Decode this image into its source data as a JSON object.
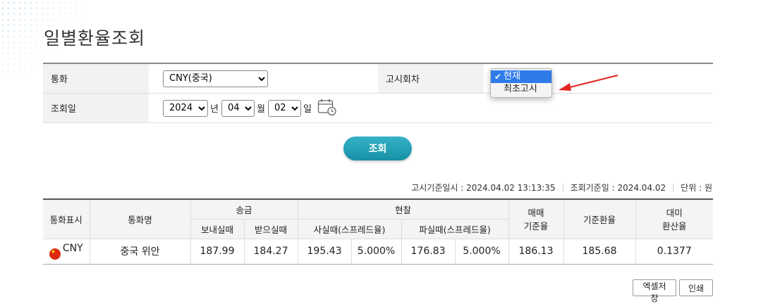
{
  "page_title": "일별환율조회",
  "form": {
    "currency_label": "통화",
    "currency_value": "CNY(중국)",
    "notice_round_label": "고시회차",
    "notice_round_options": [
      "현재",
      "최초고시"
    ],
    "notice_round_selected": "현재",
    "date_label": "조회일",
    "year": "2024",
    "year_unit": "년",
    "month": "04",
    "month_unit": "월",
    "day": "02",
    "day_unit": "일"
  },
  "search_button": "조회",
  "info": {
    "notice_datetime_label": "고시기준일시 :",
    "notice_datetime": "2024.04.02 13:13:35",
    "query_date_label": "조회기준일 :",
    "query_date": "2024.04.02",
    "unit_label": "단위 :",
    "unit": "원"
  },
  "table": {
    "headers": {
      "currency_code": "통화표시",
      "currency_name": "통화명",
      "remittance": "송금",
      "send": "보내실때",
      "receive": "받으실때",
      "cash": "현찰",
      "cash_buy": "사실때(스프레드율)",
      "cash_sell": "파실때(스프레드율)",
      "trade_base_1": "매매",
      "trade_base_2": "기준율",
      "base_rate": "기준환율",
      "usd_1": "대미",
      "usd_2": "환산율"
    },
    "rows": [
      {
        "code": "CNY",
        "name": "중국 위안",
        "send": "187.99",
        "receive": "184.27",
        "cash_buy": "195.43",
        "cash_buy_spread": "5.000%",
        "cash_sell": "176.83",
        "cash_sell_spread": "5.000%",
        "trade_base": "186.13",
        "base_rate": "185.68",
        "usd_rate": "0.1377"
      }
    ]
  },
  "buttons": {
    "excel": "엑셀저장",
    "print": "인쇄"
  },
  "colors": {
    "accent": "#1890a6",
    "arrow": "#e0261f",
    "selected_option": "#2f7bea"
  }
}
